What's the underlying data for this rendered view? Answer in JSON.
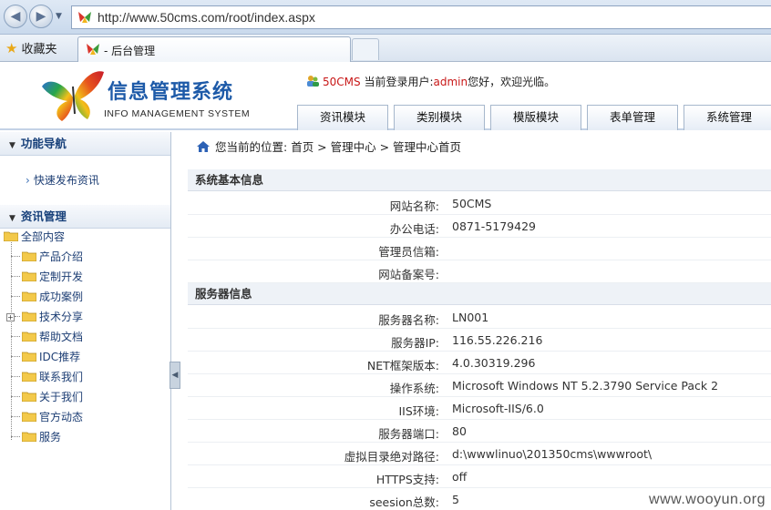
{
  "browser": {
    "url": "http://www.50cms.com/root/index.aspx",
    "favorites_label": "收藏夹",
    "tab_title": "- 后台管理"
  },
  "header": {
    "title_cn": "信息管理系统",
    "title_en": "INFO MANAGEMENT SYSTEM",
    "brand": "50CMS",
    "user_prefix": "当前登录用户:",
    "username": "admin",
    "user_suffix": "您好，欢迎光临。",
    "nav": [
      "资讯模块",
      "类别模块",
      "模版模块",
      "表单管理",
      "系统管理"
    ]
  },
  "sidebar": {
    "nav_title": "功能导航",
    "quick_link": "快速发布资讯",
    "info_title": "资讯管理",
    "tree_root": "全部内容",
    "tree_items": [
      "产品介绍",
      "定制开发",
      "成功案例",
      "技术分享",
      "帮助文档",
      "IDC推荐",
      "联系我们",
      "关于我们",
      "官方动态",
      "服务"
    ]
  },
  "breadcrumb": {
    "prefix": "您当前的位置:",
    "path": "首页 > 管理中心 > 管理中心首页"
  },
  "system_info": {
    "title": "系统基本信息",
    "rows": [
      {
        "key": "网站名称:",
        "value": "50CMS"
      },
      {
        "key": "办公电话:",
        "value": "0871-5179429"
      },
      {
        "key": "管理员信箱:",
        "value": ""
      },
      {
        "key": "网站备案号:",
        "value": ""
      }
    ]
  },
  "server_info": {
    "title": "服务器信息",
    "rows": [
      {
        "key": "服务器名称:",
        "value": "LN001"
      },
      {
        "key": "服务器IP:",
        "value": "116.55.226.216"
      },
      {
        "key": "NET框架版本:",
        "value": "4.0.30319.296"
      },
      {
        "key": "操作系统:",
        "value": "Microsoft Windows NT 5.2.3790 Service Pack 2"
      },
      {
        "key": "IIS环境:",
        "value": "Microsoft-IIS/6.0"
      },
      {
        "key": "服务器端口:",
        "value": "80"
      },
      {
        "key": "虚拟目录绝对路径:",
        "value": "d:\\wwwlinuo\\201350cms\\wwwroot\\"
      },
      {
        "key": "HTTPS支持:",
        "value": "off"
      },
      {
        "key": "seesion总数:",
        "value": "5"
      }
    ]
  },
  "watermark": "www.wooyun.org"
}
